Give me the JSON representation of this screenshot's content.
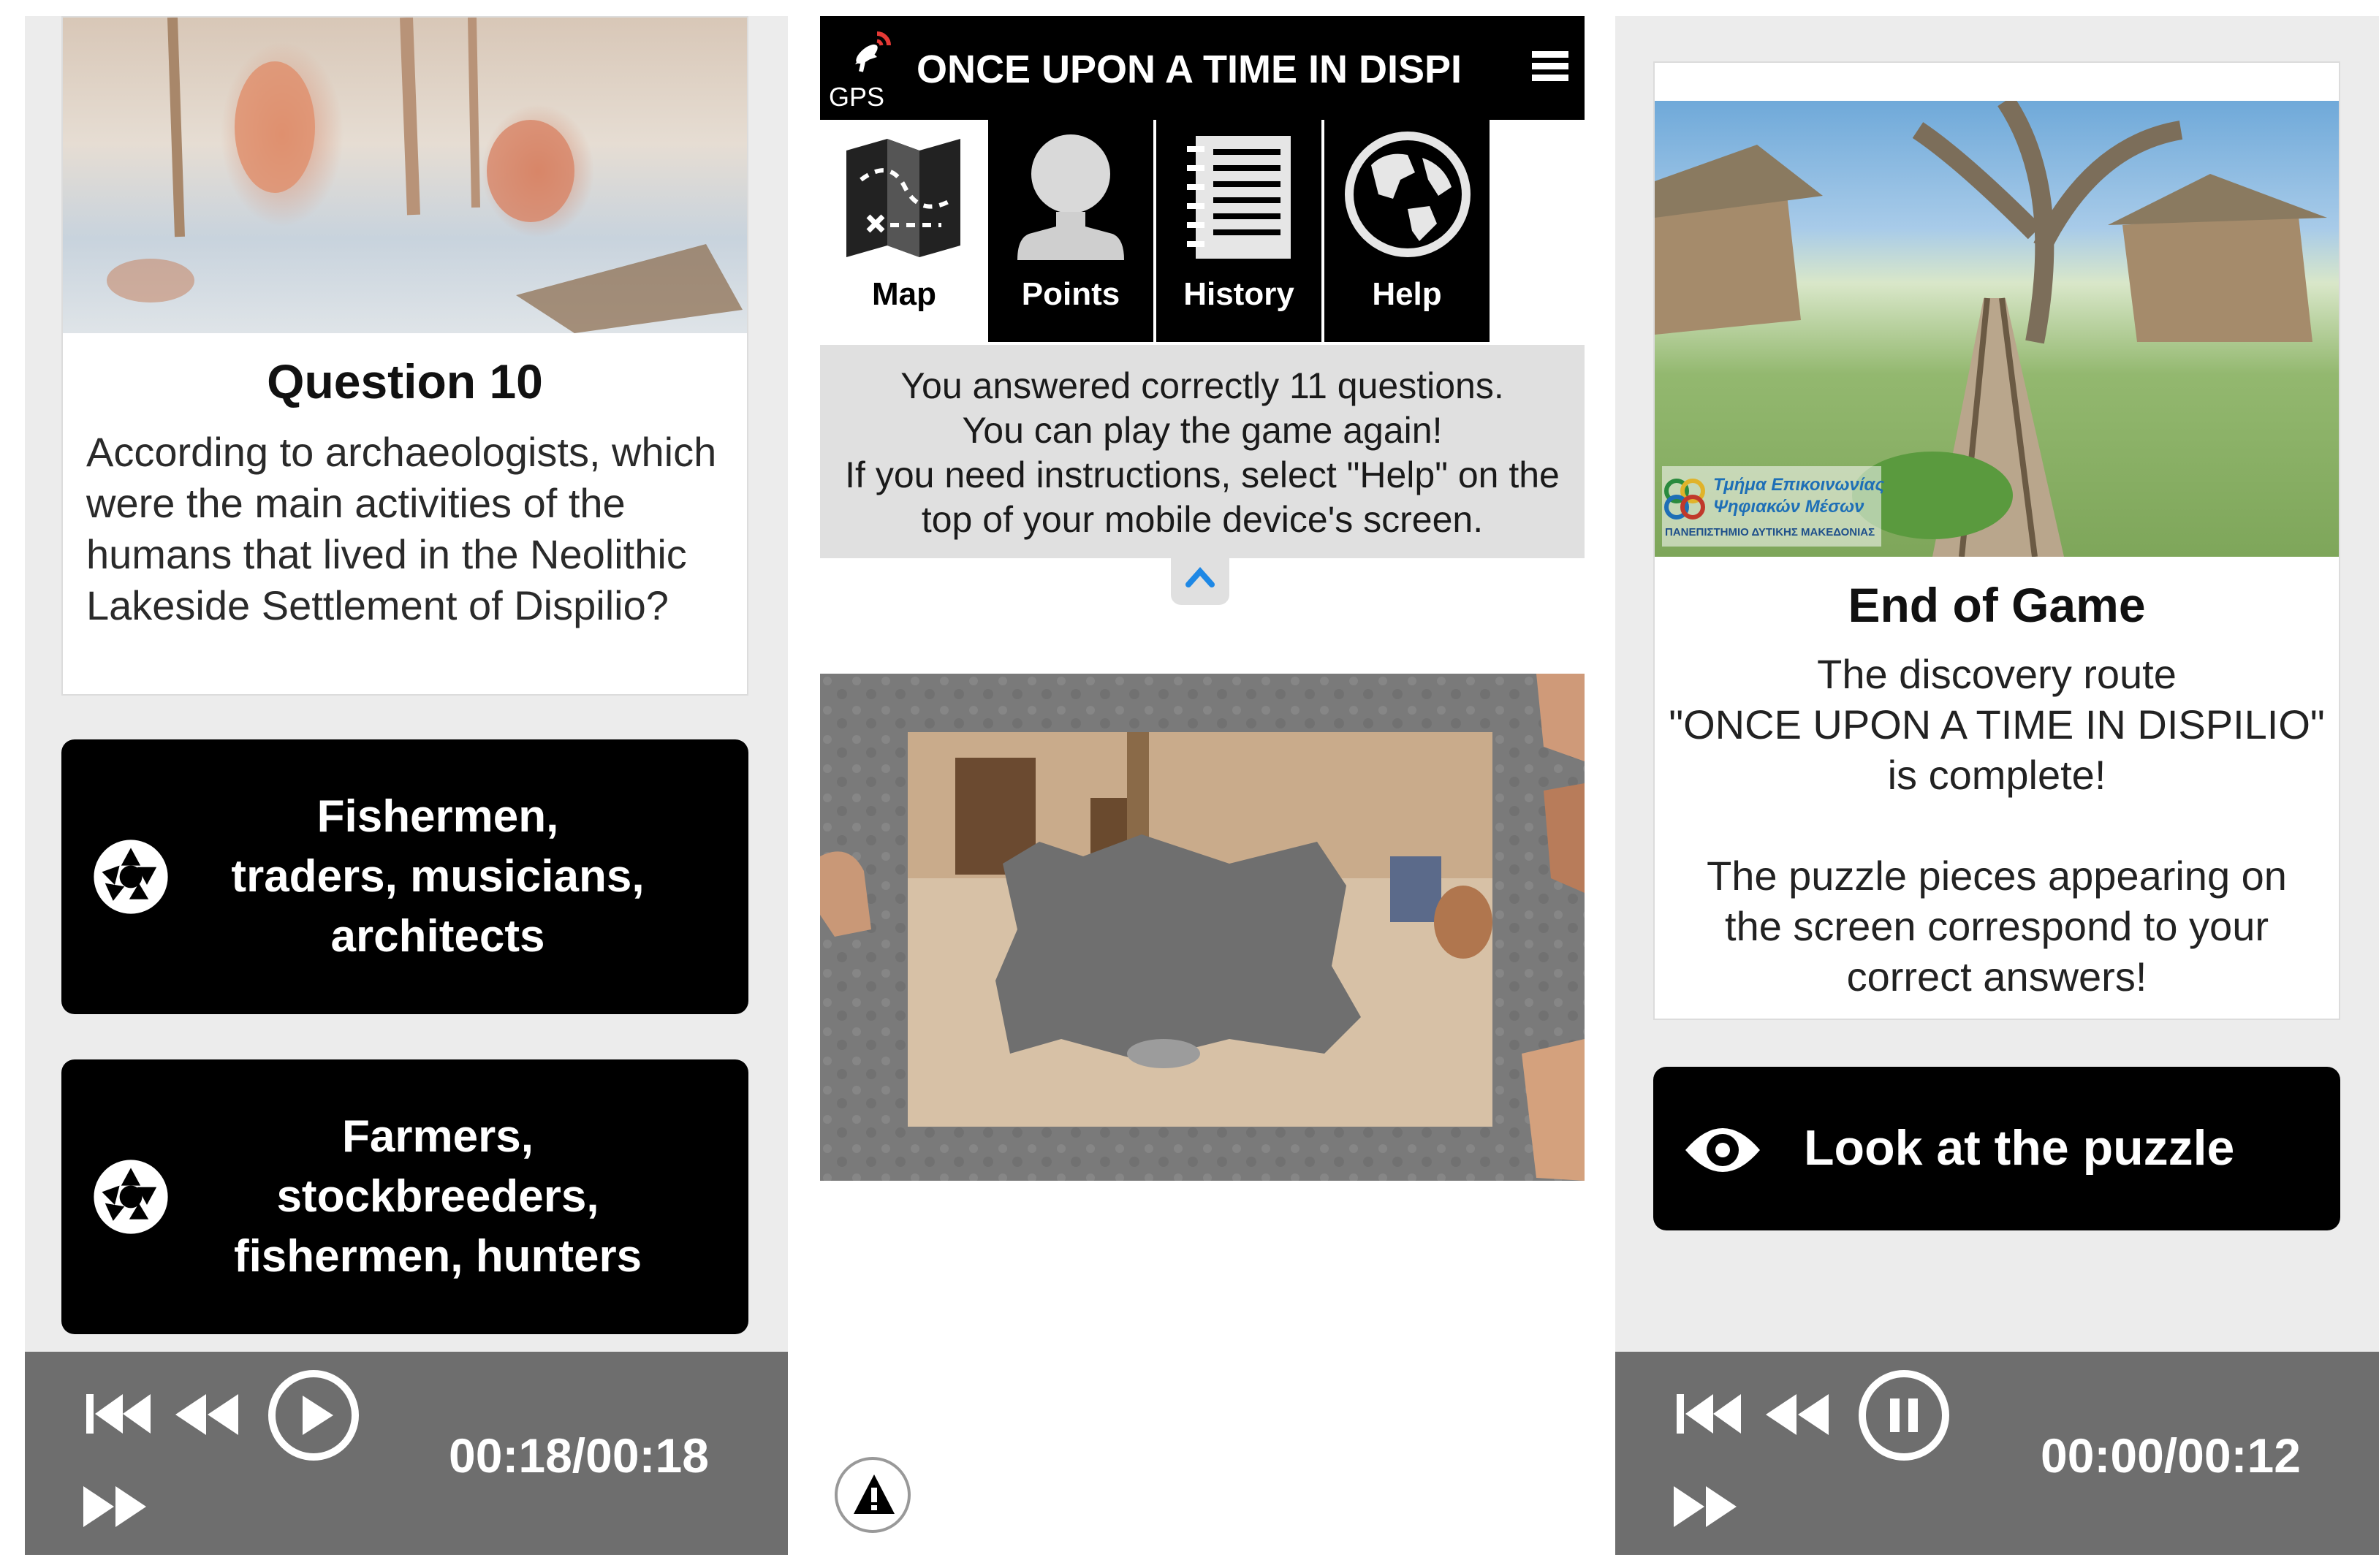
{
  "left": {
    "question_title": "Question 10",
    "question_text": "According to archaeologists, which were the main activities of the humans that lived in the Neolithic Lakeside Settlement of Dispilio?",
    "answers": [
      {
        "label": "Fishermen,\ntraders, musicians,\narchitects",
        "icon": "camera-aperture-icon"
      },
      {
        "label": "Farmers,\nstockbreeders,\nfishermen, hunters",
        "icon": "camera-aperture-icon"
      }
    ],
    "media": {
      "time": "00:18/00:18",
      "state": "play"
    }
  },
  "middle": {
    "gps_label": "GPS",
    "title": "ONCE UPON A TIME IN DISPILIO",
    "tabs": [
      {
        "label": "Map",
        "icon": "map-icon",
        "active": true
      },
      {
        "label": "Points",
        "icon": "user-icon",
        "active": false
      },
      {
        "label": "History",
        "icon": "notebook-icon",
        "active": false
      },
      {
        "label": "Help",
        "icon": "globe-icon",
        "active": false
      }
    ],
    "message_lines": [
      "You answered correctly 11 questions.",
      "You can play the game again!",
      "If you need instructions, select \"Help\" on the",
      "top of your mobile device's screen."
    ]
  },
  "right": {
    "logo_text_line1": "Τμήμα Επικοινωνίας",
    "logo_text_line2": "Ψηφιακών Μέσων",
    "logo_text_line3": "ΠΑΝΕΠΙΣΤΗΜΙΟ ΔΥΤΙΚΗΣ ΜΑΚΕΔΟΝΙΑΣ",
    "end_title": "End of Game",
    "end_text": "The discovery route\n\"ONCE UPON A TIME IN DISPILIO\"\nis complete!\n\nThe puzzle pieces appearing on\nthe screen correspond to your\ncorrect answers!",
    "look_button": "Look at the puzzle",
    "media": {
      "time": "00:00/00:12",
      "state": "pause"
    }
  },
  "colors": {
    "accent_blue": "#1e88e5",
    "button_black": "#000000",
    "media_gray": "#6e6e6e"
  }
}
